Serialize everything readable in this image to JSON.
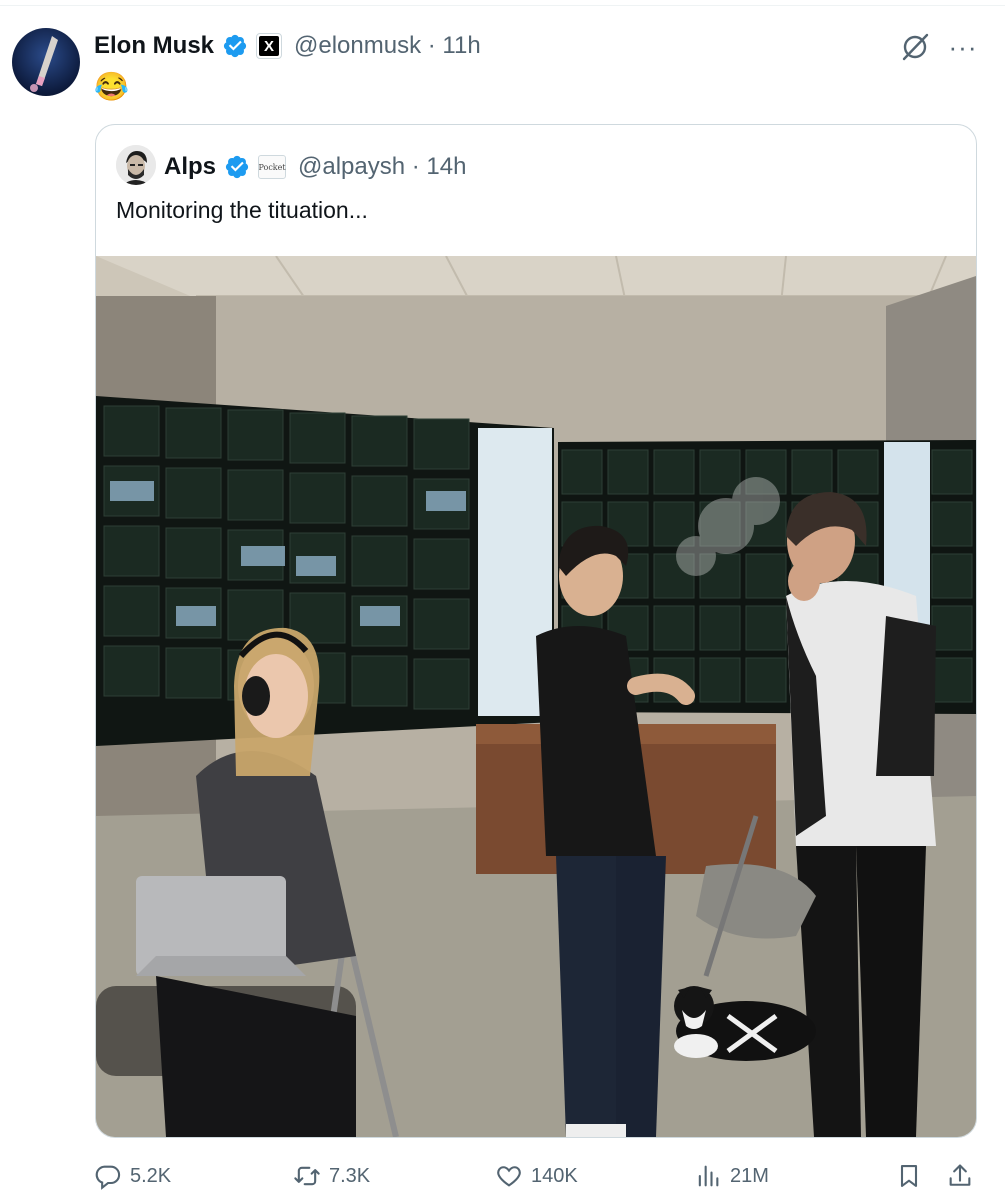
{
  "post": {
    "author_name": "Elon Musk",
    "handle_time": "@elonmusk · 11h",
    "affiliation_badge": "X",
    "text": "😂"
  },
  "quoted_post": {
    "author_name": "Alps",
    "affiliation_badge": "Pocket",
    "handle_time": "@alpaysh · 14h",
    "text": "Monitoring the tituation..."
  },
  "icons": {
    "verified": "verified-badge-icon",
    "grok": "grok-icon",
    "more": "more-icon",
    "reply": "reply-icon",
    "repost": "repost-icon",
    "like": "heart-icon",
    "views": "views-icon",
    "bookmark": "bookmark-icon",
    "share": "share-icon"
  },
  "actions": {
    "replies": "5.2K",
    "reposts": "7.3K",
    "likes": "140K",
    "views": "21M"
  },
  "colors": {
    "verified_blue": "#1d9bf0",
    "secondary_text": "#536471",
    "border": "#cfd9de"
  }
}
